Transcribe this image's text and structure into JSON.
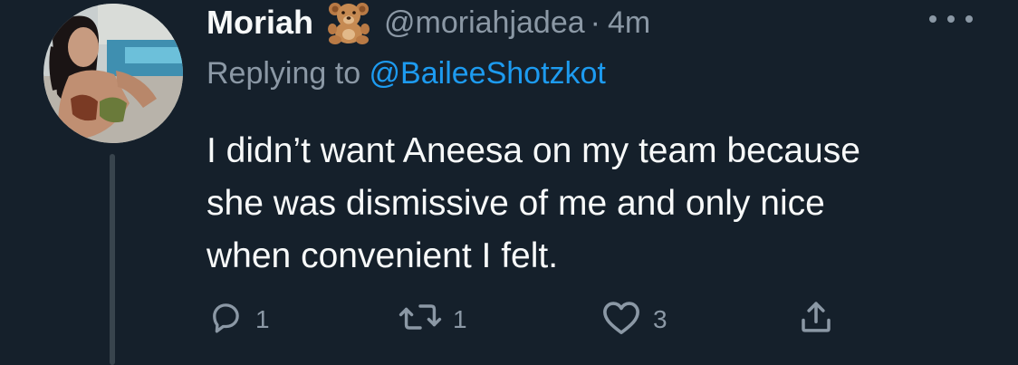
{
  "tweet": {
    "display_name": "Moriah",
    "emoji": "teddy-bear",
    "handle": "@moriahjadea",
    "separator": "·",
    "time": "4m",
    "replying_prefix": "Replying to ",
    "replying_to": "@BaileeShotzkot",
    "text_lines": [
      "I didn’t want Aneesa on my team because",
      "she was dismissive of me and only nice",
      "when convenient I felt."
    ]
  },
  "actions": {
    "reply_count": "1",
    "retweet_count": "1",
    "like_count": "3"
  },
  "colors": {
    "background": "#15202b",
    "primary_text": "#f7f9f9",
    "secondary_text": "#8b98a5",
    "link": "#1d9bf0",
    "thread_line": "#38444d"
  },
  "icons": [
    "more-icon",
    "teddy-bear-emoji",
    "reply-icon",
    "retweet-icon",
    "like-icon",
    "share-icon"
  ]
}
